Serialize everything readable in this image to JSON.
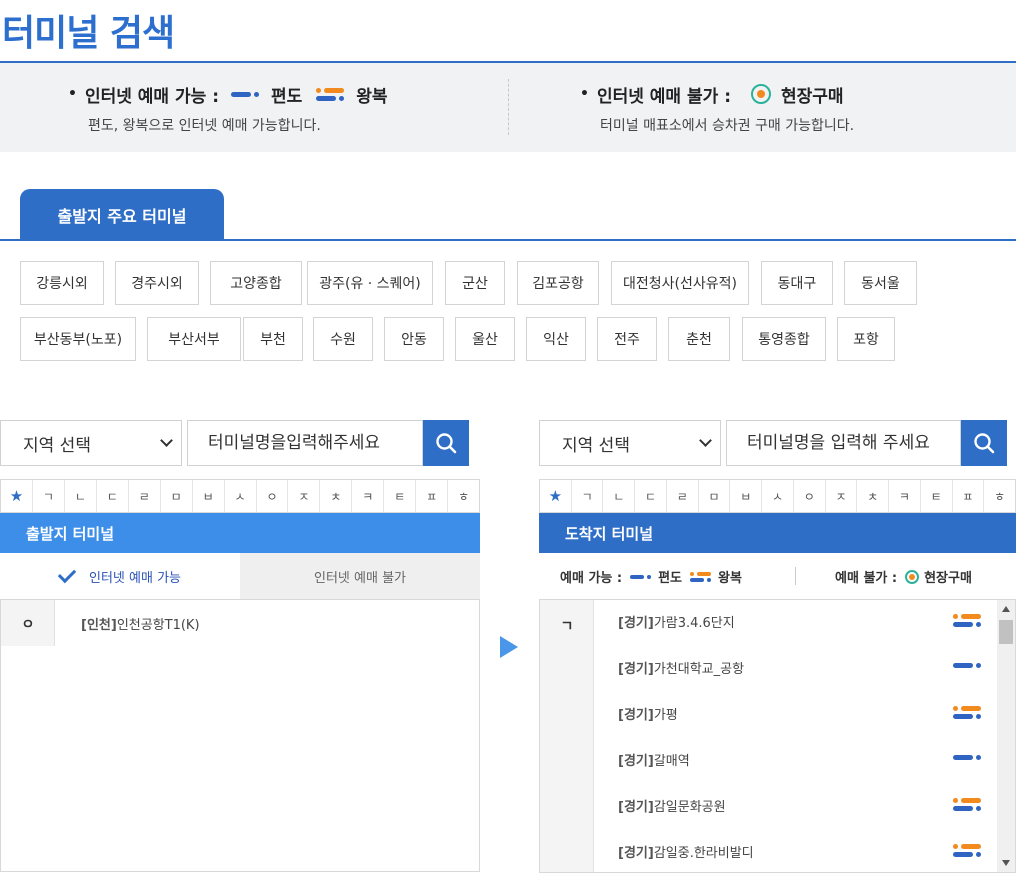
{
  "page": {
    "title": "터미널 검색"
  },
  "legend": {
    "left_label": "인터넷 예매 가능 :",
    "oneway_label": "편도",
    "round_label": "왕복",
    "left_desc": "편도, 왕복으로 인터넷 예매 가능합니다.",
    "right_label": "인터넷 예매 불가 :",
    "onsite_label": "현장구매",
    "right_desc": "터미널 매표소에서 승차권 구매 가능합니다."
  },
  "tabs": {
    "active_label": "출발지 주요 터미널"
  },
  "major_terminals": [
    "강릉시외",
    "경주시외",
    "고양종합",
    "광주(유 · 스퀘어)",
    "군산",
    "김포공항",
    "대전청사(선사유적)",
    "동대구",
    "동서울",
    "부산동부(노포)",
    "부산서부",
    "부천",
    "수원",
    "안동",
    "울산",
    "익산",
    "전주",
    "춘천",
    "통영종합",
    "포항"
  ],
  "departure": {
    "region_select": "지역 선택",
    "search_placeholder": "터미널명을입력해주세요",
    "header": "출발지 터미널",
    "tab_available": "인터넷 예매 가능",
    "tab_unavailable": "인터넷 예매 불가",
    "index_letter": "ㅇ",
    "terminals": [
      {
        "region": "[인천]",
        "name": "인천공항T1(K)"
      }
    ]
  },
  "arrival": {
    "region_select": "지역 선택",
    "search_placeholder": "터미널명을 입력해 주세요",
    "header": "도착지 터미널",
    "legend_available": "예매 가능 :",
    "legend_oneway": "편도",
    "legend_round": "왕복",
    "legend_unavailable": "예매 불가 :",
    "legend_onsite": "현장구매",
    "index_letter": "ㄱ",
    "terminals": [
      {
        "region": "[경기]",
        "name": "가람3.4.6단지",
        "type": "round"
      },
      {
        "region": "[경기]",
        "name": "가천대학교_공항",
        "type": "oneway"
      },
      {
        "region": "[경기]",
        "name": "가평",
        "type": "round"
      },
      {
        "region": "[경기]",
        "name": "갈매역",
        "type": "oneway"
      },
      {
        "region": "[경기]",
        "name": "감일문화공원",
        "type": "round"
      },
      {
        "region": "[경기]",
        "name": "감일중.한라비발디",
        "type": "round"
      }
    ]
  },
  "consonants": [
    "★",
    "ㄱ",
    "ㄴ",
    "ㄷ",
    "ㄹ",
    "ㅁ",
    "ㅂ",
    "ㅅ",
    "ㅇ",
    "ㅈ",
    "ㅊ",
    "ㅋ",
    "ㅌ",
    "ㅍ",
    "ㅎ"
  ],
  "colors": {
    "primary": "#2e6ec7",
    "oneway": "#2f64c2",
    "round_top": "#f28a1e",
    "onsite_ring": "#2bb39a"
  }
}
